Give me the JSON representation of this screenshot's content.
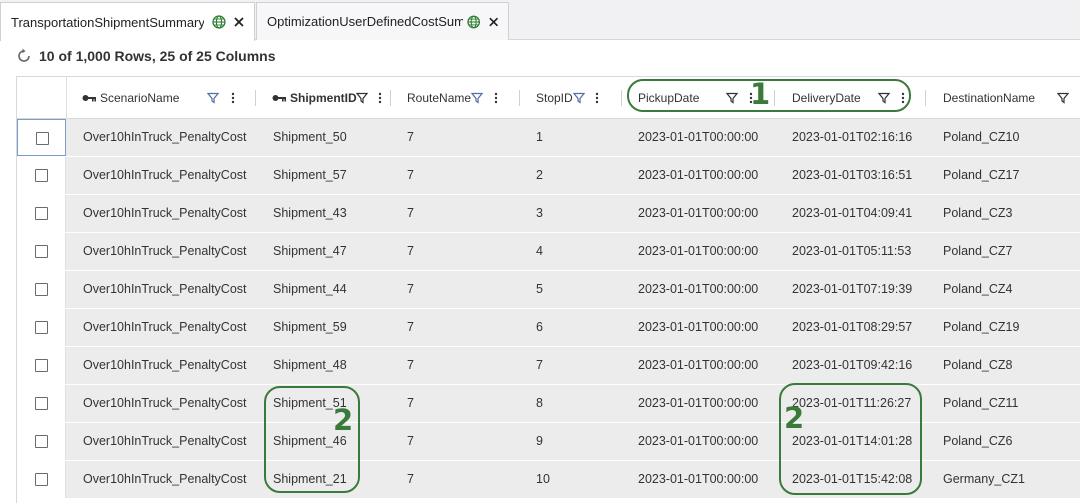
{
  "tabs": [
    {
      "label": "TransportationShipmentSummary",
      "active": true
    },
    {
      "label": "OptimizationUserDefinedCostSumı",
      "active": false
    }
  ],
  "status": {
    "text": "10 of 1,000 Rows, 25 of 25 Columns"
  },
  "columns": [
    {
      "label": "ScenarioName",
      "key": true
    },
    {
      "label": "ShipmentID",
      "key": true
    },
    {
      "label": "RouteName",
      "key": false
    },
    {
      "label": "StopID",
      "key": false
    },
    {
      "label": "PickupDate",
      "key": false
    },
    {
      "label": "DeliveryDate",
      "key": false
    },
    {
      "label": "DestinationName",
      "key": false
    }
  ],
  "rows": [
    {
      "scenario": "Over10hInTruck_PenaltyCost",
      "shipment": "Shipment_50",
      "route": "7",
      "stop": "1",
      "pickup": "2023-01-01T00:00:00",
      "delivery": "2023-01-01T02:16:16",
      "destination": "Poland_CZ10"
    },
    {
      "scenario": "Over10hInTruck_PenaltyCost",
      "shipment": "Shipment_57",
      "route": "7",
      "stop": "2",
      "pickup": "2023-01-01T00:00:00",
      "delivery": "2023-01-01T03:16:51",
      "destination": "Poland_CZ17"
    },
    {
      "scenario": "Over10hInTruck_PenaltyCost",
      "shipment": "Shipment_43",
      "route": "7",
      "stop": "3",
      "pickup": "2023-01-01T00:00:00",
      "delivery": "2023-01-01T04:09:41",
      "destination": "Poland_CZ3"
    },
    {
      "scenario": "Over10hInTruck_PenaltyCost",
      "shipment": "Shipment_47",
      "route": "7",
      "stop": "4",
      "pickup": "2023-01-01T00:00:00",
      "delivery": "2023-01-01T05:11:53",
      "destination": "Poland_CZ7"
    },
    {
      "scenario": "Over10hInTruck_PenaltyCost",
      "shipment": "Shipment_44",
      "route": "7",
      "stop": "5",
      "pickup": "2023-01-01T00:00:00",
      "delivery": "2023-01-01T07:19:39",
      "destination": "Poland_CZ4"
    },
    {
      "scenario": "Over10hInTruck_PenaltyCost",
      "shipment": "Shipment_59",
      "route": "7",
      "stop": "6",
      "pickup": "2023-01-01T00:00:00",
      "delivery": "2023-01-01T08:29:57",
      "destination": "Poland_CZ19"
    },
    {
      "scenario": "Over10hInTruck_PenaltyCost",
      "shipment": "Shipment_48",
      "route": "7",
      "stop": "7",
      "pickup": "2023-01-01T00:00:00",
      "delivery": "2023-01-01T09:42:16",
      "destination": "Poland_CZ8"
    },
    {
      "scenario": "Over10hInTruck_PenaltyCost",
      "shipment": "Shipment_51",
      "route": "7",
      "stop": "8",
      "pickup": "2023-01-01T00:00:00",
      "delivery": "2023-01-01T11:26:27",
      "destination": "Poland_CZ11"
    },
    {
      "scenario": "Over10hInTruck_PenaltyCost",
      "shipment": "Shipment_46",
      "route": "7",
      "stop": "9",
      "pickup": "2023-01-01T00:00:00",
      "delivery": "2023-01-01T14:01:28",
      "destination": "Poland_CZ6"
    },
    {
      "scenario": "Over10hInTruck_PenaltyCost",
      "shipment": "Shipment_21",
      "route": "7",
      "stop": "10",
      "pickup": "2023-01-01T00:00:00",
      "delivery": "2023-01-01T15:42:08",
      "destination": "Germany_CZ1"
    }
  ],
  "annotations": [
    {
      "number": "1"
    },
    {
      "number": "2"
    },
    {
      "number": "2"
    }
  ],
  "icons": {
    "globe": "globe-icon",
    "close": "close-icon",
    "refresh": "refresh-icon",
    "key": "key-icon",
    "filter": "filter-icon",
    "menu": "kebab-menu-icon"
  },
  "colors": {
    "annotation": "#3a7a3a",
    "row_background": "#ececec",
    "active_row_border": "#7a9cc6"
  }
}
